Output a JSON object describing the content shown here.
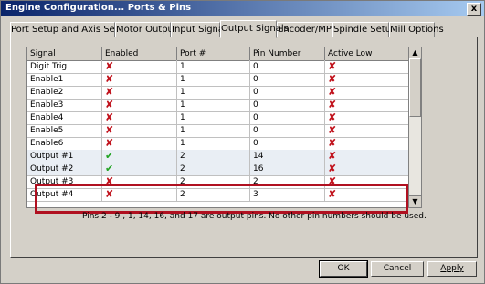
{
  "window": {
    "title": "Engine Configuration... Ports & Pins",
    "close_label": "x"
  },
  "tabs": [
    {
      "label": "Port Setup and Axis Selection"
    },
    {
      "label": "Motor Outputs"
    },
    {
      "label": "Input Signals"
    },
    {
      "label": "Output Signals"
    },
    {
      "label": "Encoder/MPG's"
    },
    {
      "label": "Spindle Setup"
    },
    {
      "label": "Mill Options"
    }
  ],
  "table": {
    "columns": [
      "Signal",
      "Enabled",
      "Port #",
      "Pin Number",
      "Active Low"
    ],
    "rows": [
      {
        "signal": "Digit  Trig",
        "enabled": "no",
        "port": "1",
        "pin": "0",
        "active_low": "no"
      },
      {
        "signal": "Enable1",
        "enabled": "no",
        "port": "1",
        "pin": "0",
        "active_low": "no"
      },
      {
        "signal": "Enable2",
        "enabled": "no",
        "port": "1",
        "pin": "0",
        "active_low": "no"
      },
      {
        "signal": "Enable3",
        "enabled": "no",
        "port": "1",
        "pin": "0",
        "active_low": "no"
      },
      {
        "signal": "Enable4",
        "enabled": "no",
        "port": "1",
        "pin": "0",
        "active_low": "no"
      },
      {
        "signal": "Enable5",
        "enabled": "no",
        "port": "1",
        "pin": "0",
        "active_low": "no"
      },
      {
        "signal": "Enable6",
        "enabled": "no",
        "port": "1",
        "pin": "0",
        "active_low": "no"
      },
      {
        "signal": "Output #1",
        "enabled": "yes",
        "port": "2",
        "pin": "14",
        "active_low": "no"
      },
      {
        "signal": "Output #2",
        "enabled": "yes",
        "port": "2",
        "pin": "16",
        "active_low": "no"
      },
      {
        "signal": "Output #3",
        "enabled": "no",
        "port": "2",
        "pin": "2",
        "active_low": "no"
      },
      {
        "signal": "Output #4",
        "enabled": "no",
        "port": "2",
        "pin": "3",
        "active_low": "no"
      }
    ]
  },
  "icons": {
    "enabled_yes": "check-icon",
    "enabled_no": "x-icon",
    "check_glyph": "✔",
    "x_glyph": "✘"
  },
  "colors": {
    "highlight_box": "#b01020",
    "titlebar_start": "#0a246a",
    "titlebar_end": "#a6caf0"
  },
  "note": "Pins 2 - 9 , 1, 14, 16, and 17 are output pins. No  other pin numbers should be used.",
  "buttons": {
    "ok": "OK",
    "cancel": "Cancel",
    "apply": "Apply"
  }
}
